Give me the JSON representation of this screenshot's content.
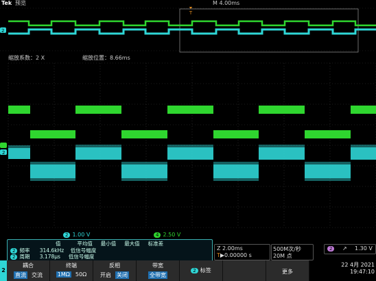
{
  "header": {
    "brand": "Tek",
    "mode": "预览",
    "timebase": "M 4.00ms",
    "overview_channel_marker": "2"
  },
  "zoom": {
    "factor_label": "缩放系数：2 X",
    "position_label": "缩放位置：8.66ms"
  },
  "channels": {
    "ch2": {
      "label": "2",
      "scale": "1.00 V",
      "color": "#2fd6d6"
    },
    "ch4": {
      "label": "4",
      "scale": "2.50 V",
      "color": "#2fd62f"
    }
  },
  "measurements": {
    "headers": [
      "值",
      "平均值",
      "最小值",
      "最大值",
      "标准差"
    ],
    "rows": [
      {
        "chip": "2",
        "name": "频率",
        "value": "314.6kHz",
        "note": "低信号幅度"
      },
      {
        "chip": "2",
        "name": "周期",
        "value": "3.178μs",
        "note": "低信号幅度"
      }
    ]
  },
  "horizontal": {
    "scale": "2.00ms",
    "position": "▶0.00000 s",
    "scale_prefix": "Z",
    "pos_prefix": "T"
  },
  "acquisition": {
    "rate": "500M次/秒",
    "points": "20M 点"
  },
  "trigger": {
    "channel": "2",
    "slope": "↗",
    "level": "1.30 V"
  },
  "bottom_menu": {
    "channel_tab": "2",
    "coupling": {
      "title": "耦合",
      "options": [
        "直流",
        "交流"
      ],
      "selected": 0
    },
    "termination": {
      "title": "终端",
      "options": [
        "1MΩ",
        "50Ω"
      ],
      "selected": 0
    },
    "invert": {
      "title": "反相",
      "options": [
        "开启",
        "关闭"
      ],
      "selected": 1
    },
    "bandwidth": {
      "title": "带宽",
      "value": "全带宽"
    },
    "label": {
      "chip": "2",
      "title": "标签"
    },
    "more": "更多"
  },
  "datetime": {
    "date": "22 4月 2021",
    "time": "19:47:10"
  },
  "colors": {
    "ch2": "#2fd6d6",
    "ch4": "#2fd62f",
    "trigger": "#e08a1e",
    "grid": "#444"
  }
}
